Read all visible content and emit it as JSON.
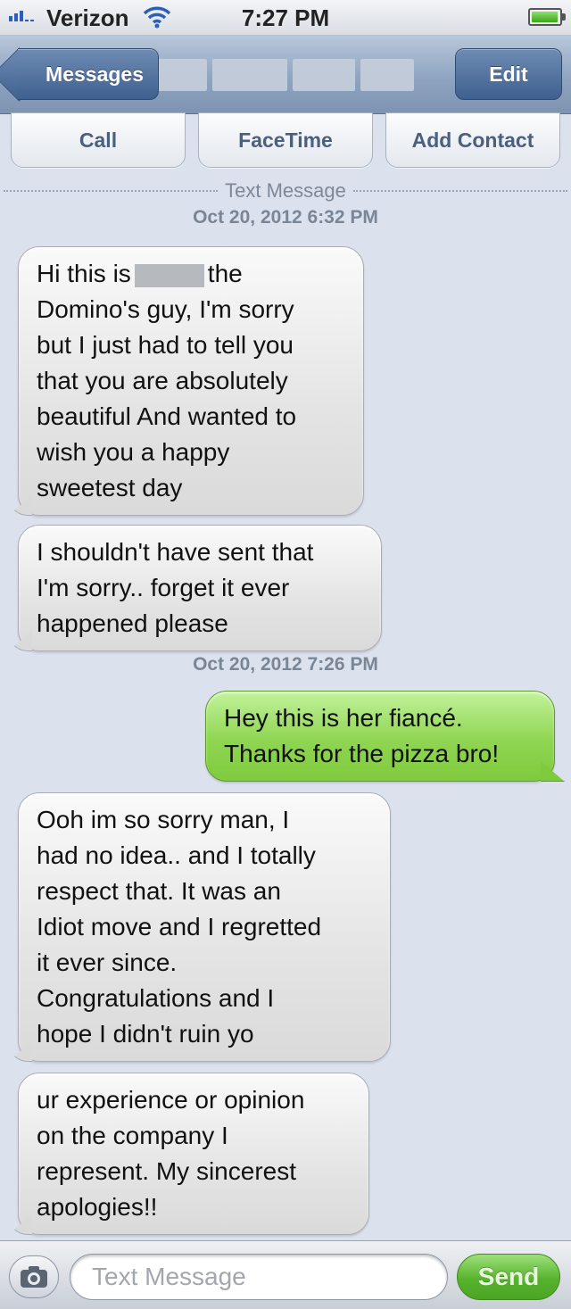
{
  "status_bar": {
    "carrier": "Verizon",
    "time": "7:27 PM",
    "signal_bars": 3,
    "battery_level": 0.95
  },
  "nav_bar": {
    "back_label": "Messages",
    "edit_label": "Edit"
  },
  "actions": {
    "call_label": "Call",
    "facetime_label": "FaceTime",
    "add_contact_label": "Add Contact"
  },
  "thread": {
    "header_label": "Text Message",
    "timestamps": [
      "Oct 20, 2012 6:32 PM",
      "Oct 20, 2012 7:26 PM"
    ],
    "messages": [
      {
        "direction": "incoming",
        "lines": [
          "Hi this is",
          "the",
          "Domino's guy, I'm sorry",
          "but I just had to tell you",
          "that you are absolutely",
          "beautiful And wanted to",
          "wish you a happy",
          "sweetest day"
        ]
      },
      {
        "direction": "incoming",
        "lines": [
          "I shouldn't have sent that",
          "I'm sorry.. forget it ever",
          "happened please"
        ]
      },
      {
        "direction": "outgoing",
        "lines": [
          "Hey this is her fiancé.",
          "Thanks for the pizza bro!"
        ]
      },
      {
        "direction": "incoming",
        "lines": [
          "Ooh im so sorry man, I",
          "had no idea.. and I totally",
          "respect that. It was an",
          "Idiot move and I regretted",
          "it ever since.",
          "Congratulations and I",
          "hope I didn't ruin yo"
        ]
      },
      {
        "direction": "incoming",
        "lines": [
          "ur experience or opinion",
          "on the company I",
          "represent. My sincerest",
          "apologies!!"
        ]
      }
    ]
  },
  "composer": {
    "placeholder": "Text Message",
    "send_label": "Send"
  },
  "colors": {
    "background": "#dbe2ed",
    "nav_blue": "#3f618f",
    "incoming_bubble": "#e4e4e4",
    "outgoing_bubble": "#8fd552",
    "send_green": "#57b32e"
  }
}
